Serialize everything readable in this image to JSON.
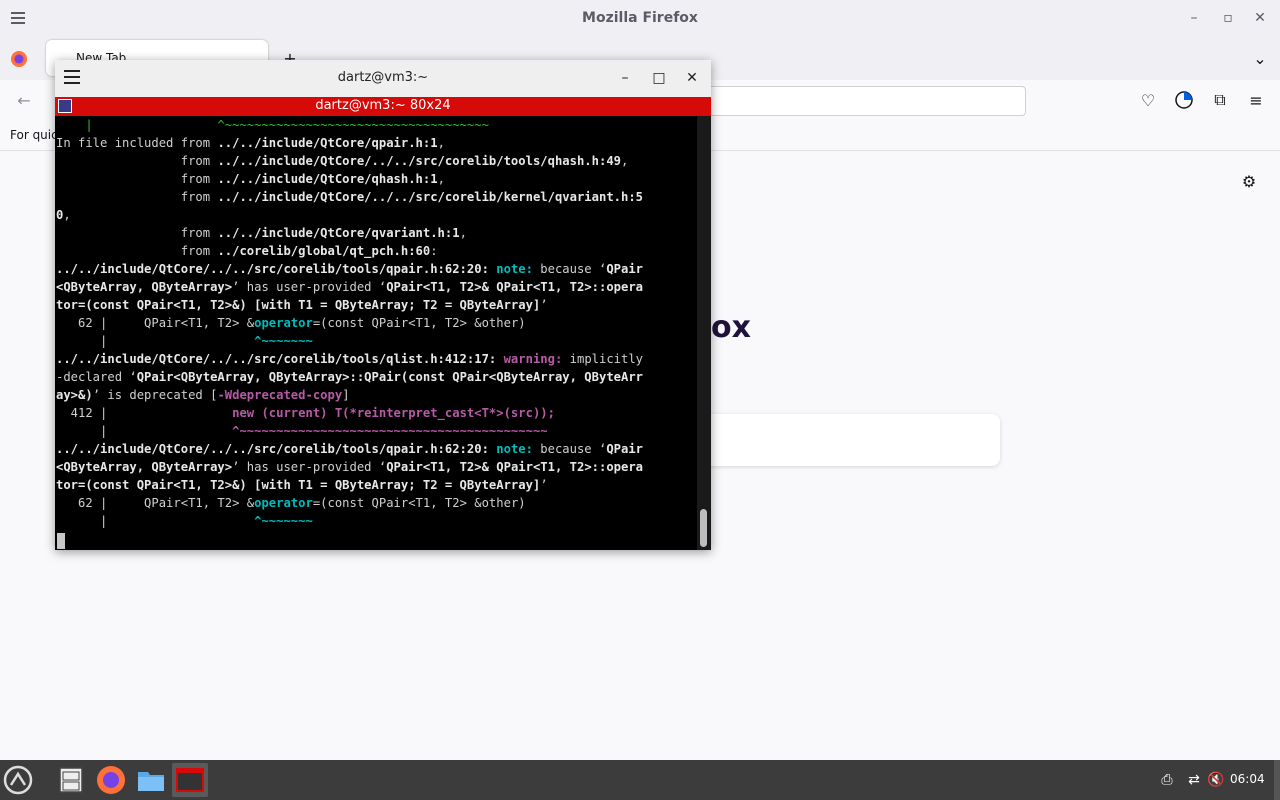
{
  "firefox": {
    "title": "Mozilla Firefox",
    "tab_label": "New Tab",
    "bookmarks_hint": "For quic",
    "logo_text": "ox"
  },
  "terminal": {
    "title": "dartz@vm3:~",
    "inner_title": "dartz@vm3:~ 80x24",
    "lines": [
      [
        {
          "t": "    |                 ^~~~~~~~~~~~~~~~~~~~~~~~~~~~~~~~~~~~~",
          "c": "gr"
        }
      ],
      [
        {
          "t": "In file included from ",
          "c": ""
        },
        {
          "t": "../../include/QtCore/qpair.h:1",
          "c": "b"
        },
        {
          "t": ",",
          "c": ""
        }
      ],
      [
        {
          "t": "                 from ",
          "c": ""
        },
        {
          "t": "../../include/QtCore/../../src/corelib/tools/qhash.h:49",
          "c": "b"
        },
        {
          "t": ",",
          "c": ""
        }
      ],
      [
        {
          "t": "                 from ",
          "c": ""
        },
        {
          "t": "../../include/QtCore/qhash.h:1",
          "c": "b"
        },
        {
          "t": ",",
          "c": ""
        }
      ],
      [
        {
          "t": "                 from ",
          "c": ""
        },
        {
          "t": "../../include/QtCore/../../src/corelib/kernel/qvariant.h:5",
          "c": "b"
        }
      ],
      [
        {
          "t": "0",
          "c": "b"
        },
        {
          "t": ",",
          "c": ""
        }
      ],
      [
        {
          "t": "                 from ",
          "c": ""
        },
        {
          "t": "../../include/QtCore/qvariant.h:1",
          "c": "b"
        },
        {
          "t": ",",
          "c": ""
        }
      ],
      [
        {
          "t": "                 from ",
          "c": ""
        },
        {
          "t": "../corelib/global/qt_pch.h:60",
          "c": "b"
        },
        {
          "t": ":",
          "c": ""
        }
      ],
      [
        {
          "t": "../../include/QtCore/../../src/corelib/tools/qpair.h:62:20: ",
          "c": "b"
        },
        {
          "t": "note: ",
          "c": "cy"
        },
        {
          "t": "because ‘",
          "c": ""
        },
        {
          "t": "QPair",
          "c": "b"
        }
      ],
      [
        {
          "t": "<QByteArray, QByteArray>",
          "c": "b"
        },
        {
          "t": "’ has user-provided ‘",
          "c": ""
        },
        {
          "t": "QPair<T1, T2>& QPair<T1, T2>::opera",
          "c": "b"
        }
      ],
      [
        {
          "t": "tor=(const QPair<T1, T2>&) [with T1 = QByteArray; T2 = QByteArray]",
          "c": "b"
        },
        {
          "t": "’",
          "c": ""
        }
      ],
      [
        {
          "t": "   62 |     QPair<T1, T2> &",
          "c": ""
        },
        {
          "t": "operator",
          "c": "cy"
        },
        {
          "t": "=(const QPair<T1, T2> &other)",
          "c": ""
        }
      ],
      [
        {
          "t": "      |                    ",
          "c": ""
        },
        {
          "t": "^~~~~~~~",
          "c": "cy"
        }
      ],
      [
        {
          "t": "../../include/QtCore/../../src/corelib/tools/qlist.h:412:17: ",
          "c": "b"
        },
        {
          "t": "warning: ",
          "c": "mg"
        },
        {
          "t": "implicitly",
          "c": ""
        }
      ],
      [
        {
          "t": "-declared ‘",
          "c": ""
        },
        {
          "t": "QPair<QByteArray, QByteArray>::QPair(const QPair<QByteArray, QByteArr",
          "c": "b"
        }
      ],
      [
        {
          "t": "ay>&)",
          "c": "b"
        },
        {
          "t": "’ is deprecated [",
          "c": ""
        },
        {
          "t": "-Wdeprecated-copy",
          "c": "mg"
        },
        {
          "t": "]",
          "c": ""
        }
      ],
      [
        {
          "t": "  412 |                 ",
          "c": ""
        },
        {
          "t": "new (current) T(*reinterpret_cast<T*>(src));",
          "c": "mg"
        }
      ],
      [
        {
          "t": "      |                 ",
          "c": ""
        },
        {
          "t": "^~~~~~~~~~~~~~~~~~~~~~~~~~~~~~~~~~~~~~~~~~~",
          "c": "mg"
        }
      ],
      [
        {
          "t": "../../include/QtCore/../../src/corelib/tools/qpair.h:62:20: ",
          "c": "b"
        },
        {
          "t": "note: ",
          "c": "cy"
        },
        {
          "t": "because ‘",
          "c": ""
        },
        {
          "t": "QPair",
          "c": "b"
        }
      ],
      [
        {
          "t": "<QByteArray, QByteArray>",
          "c": "b"
        },
        {
          "t": "’ has user-provided ‘",
          "c": ""
        },
        {
          "t": "QPair<T1, T2>& QPair<T1, T2>::opera",
          "c": "b"
        }
      ],
      [
        {
          "t": "tor=(const QPair<T1, T2>&) [with T1 = QByteArray; T2 = QByteArray]",
          "c": "b"
        },
        {
          "t": "’",
          "c": ""
        }
      ],
      [
        {
          "t": "   62 |     QPair<T1, T2> &",
          "c": ""
        },
        {
          "t": "operator",
          "c": "cy"
        },
        {
          "t": "=(const QPair<T1, T2> &other)",
          "c": ""
        }
      ],
      [
        {
          "t": "      |                    ",
          "c": ""
        },
        {
          "t": "^~~~~~~~",
          "c": "cy"
        }
      ]
    ]
  },
  "taskbar": {
    "clock": "06:04"
  },
  "colors": {
    "terminal_accent": "#d70a0a",
    "note": "#00bcbc",
    "warning": "#b75aa5"
  }
}
